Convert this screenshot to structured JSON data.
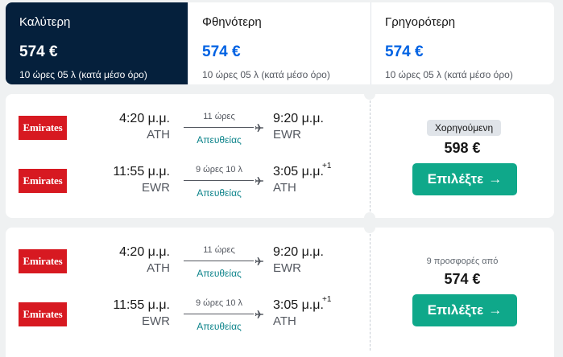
{
  "tabs": [
    {
      "label": "Καλύτερη",
      "price": "574 €",
      "duration": "10 ώρες 05 λ (κατά μέσο όρο)",
      "active": true
    },
    {
      "label": "Φθηνότερη",
      "price": "574 €",
      "duration": "10 ώρες 05 λ (κατά μέσο όρο)",
      "active": false
    },
    {
      "label": "Γρηγορότερη",
      "price": "574 €",
      "duration": "10 ώρες 05 λ (κατά μέσο όρο)",
      "active": false
    }
  ],
  "results": [
    {
      "legs": [
        {
          "airline": "Emirates",
          "dep_time": "4:20 μ.μ.",
          "dep_code": "ATH",
          "duration": "11 ώρες",
          "stops": "Απευθείας",
          "arr_time": "9:20 μ.μ.",
          "arr_code": "EWR",
          "day_offset": ""
        },
        {
          "airline": "Emirates",
          "dep_time": "11:55 μ.μ.",
          "dep_code": "EWR",
          "duration": "9 ώρες 10 λ",
          "stops": "Απευθείας",
          "arr_time": "3:05 μ.μ.",
          "arr_code": "ATH",
          "day_offset": "+1"
        }
      ],
      "badge": "Χορηγούμενη",
      "offers_text": "",
      "price": "598 €",
      "select_label": "Επιλέξτε"
    },
    {
      "legs": [
        {
          "airline": "Emirates",
          "dep_time": "4:20 μ.μ.",
          "dep_code": "ATH",
          "duration": "11 ώρες",
          "stops": "Απευθείας",
          "arr_time": "9:20 μ.μ.",
          "arr_code": "EWR",
          "day_offset": ""
        },
        {
          "airline": "Emirates",
          "dep_time": "11:55 μ.μ.",
          "dep_code": "EWR",
          "duration": "9 ώρες 10 λ",
          "stops": "Απευθείας",
          "arr_time": "3:05 μ.μ.",
          "arr_code": "ATH",
          "day_offset": "+1"
        }
      ],
      "badge": "",
      "offers_text": "9 προσφορές από",
      "price": "574 €",
      "select_label": "Επιλέξτε"
    }
  ],
  "icons": {
    "plane": "plane-icon",
    "arrow": "arrow-right-icon"
  },
  "colors": {
    "active_tab": "#05203c",
    "price_link": "#0062e3",
    "select_button": "#0fa88a",
    "stops_text": "#0c838a",
    "airline_logo": "#d71921"
  }
}
